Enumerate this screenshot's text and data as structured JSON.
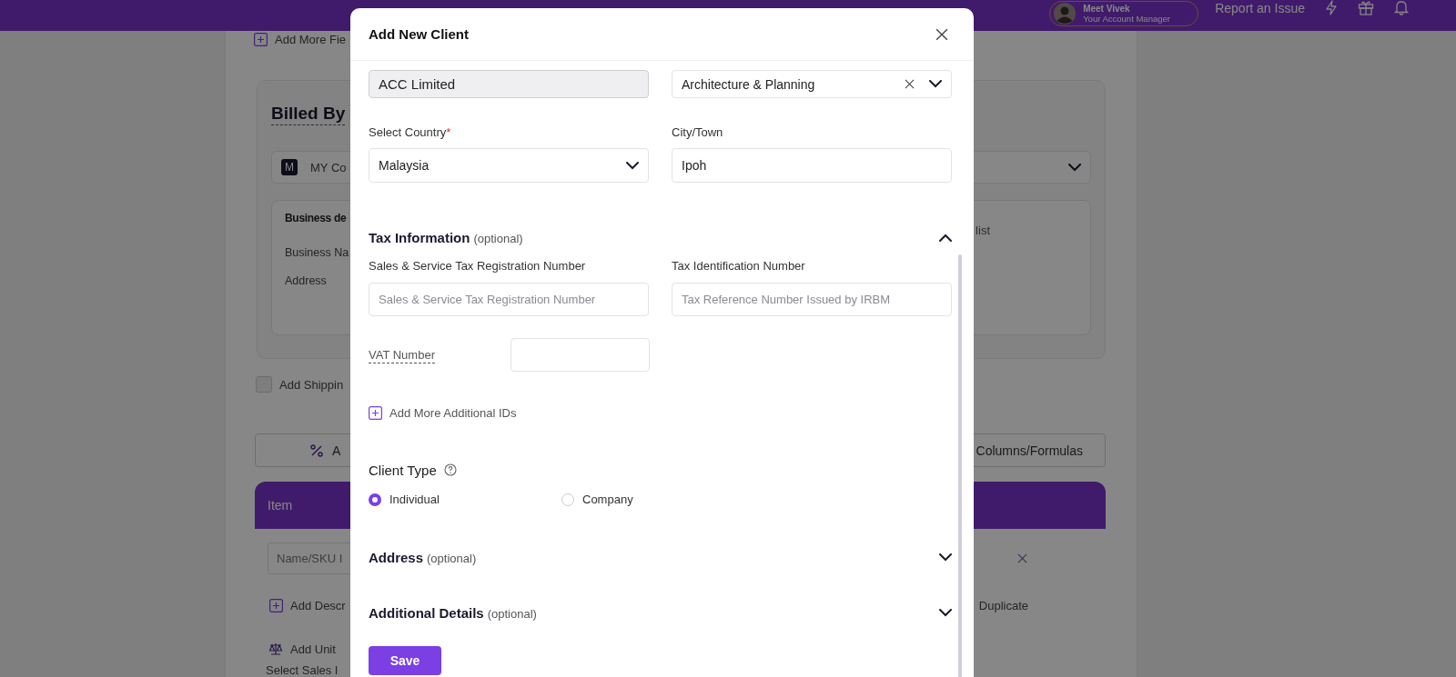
{
  "top_bar": {
    "account_manager": {
      "title": "Meet Vivek",
      "subtitle": "Your Account Manager"
    },
    "report_link": "Report an Issue"
  },
  "background": {
    "add_fields": "Add More Fie",
    "billed_by": {
      "title": "Billed By",
      "business_badge": "M",
      "business_name": "MY Co",
      "details_title": "Business de",
      "details_rows": [
        "Business Na",
        "Address"
      ],
      "side_text": "list"
    },
    "shipping": {
      "label": "Add Shippin",
      "checked": false
    },
    "actions": [
      {
        "kind": "discount",
        "label": "A"
      },
      {
        "kind": "columns",
        "label": "Columns/Formulas"
      }
    ],
    "table": {
      "columns": [
        "Item"
      ],
      "name_placeholder": "Name/SKU I",
      "add_description": "Add Descr",
      "duplicate": "Duplicate",
      "add_unit": "Add Unit",
      "sales_label": "Select Sales I"
    }
  },
  "modal": {
    "title": "Add New Client",
    "top_fields": [
      {
        "kind": "input",
        "value": "ACC Limited",
        "disabled": true
      },
      {
        "kind": "select",
        "value": "Architecture & Planning",
        "clearable": true
      }
    ],
    "location_fields": [
      {
        "kind": "select",
        "label": "Select Country",
        "required_mark": "*",
        "value": "Malaysia"
      },
      {
        "kind": "input",
        "label": "City/Town",
        "value": "Ipoh"
      }
    ],
    "tax_section": {
      "title": "Tax Information",
      "note": "(optional)",
      "expanded": true,
      "fields": [
        {
          "label": "Sales & Service Tax Registration Number",
          "placeholder": "Sales & Service Tax Registration Number"
        },
        {
          "label": "Tax Identification Number",
          "placeholder": "Tax Reference Number Issued by IRBM"
        }
      ],
      "vat_label": "VAT Number",
      "add_ids": "Add More Additional IDs"
    },
    "client_type": {
      "label": "Client Type",
      "options": [
        {
          "label": "Individual",
          "selected": true
        },
        {
          "label": "Company",
          "selected": false
        }
      ]
    },
    "more_sections": [
      {
        "title": "Address",
        "note": "(optional)",
        "expanded": false
      },
      {
        "title": "Additional Details",
        "note": "(optional)",
        "expanded": false
      }
    ],
    "save_button": "Save"
  }
}
